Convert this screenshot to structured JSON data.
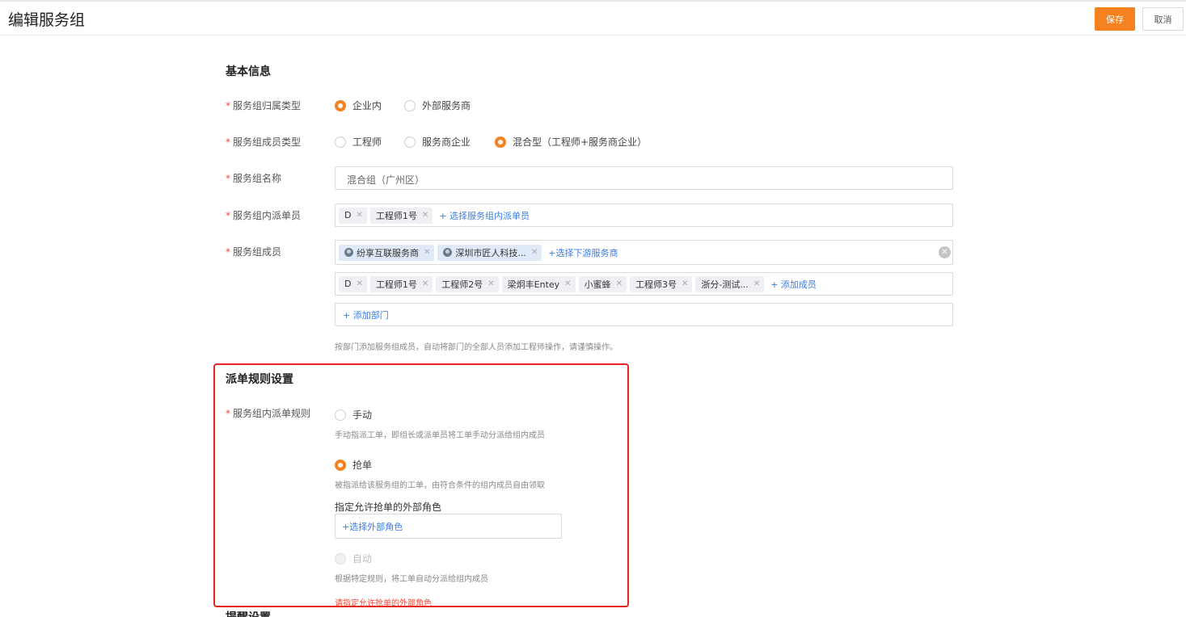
{
  "header": {
    "title": "编辑服务组",
    "save_label": "保存",
    "cancel_label": "取消"
  },
  "basic_info": {
    "section_title": "基本信息",
    "ownership_type": {
      "label": "服务组归属类型",
      "options": [
        "企业内",
        "外部服务商"
      ],
      "selected": "企业内"
    },
    "member_type": {
      "label": "服务组成员类型",
      "options": [
        "工程师",
        "服务商企业",
        "混合型（工程师+服务商企业）"
      ],
      "selected": "混合型（工程师+服务商企业）"
    },
    "group_name": {
      "label": "服务组名称",
      "value": "混合组（广州区）"
    },
    "dispatchers": {
      "label": "服务组内派单员",
      "tags": [
        "D",
        "工程师1号"
      ],
      "add_link": "+ 选择服务组内派单员"
    },
    "members": {
      "label": "服务组成员",
      "provider_tags": [
        "纷享互联服务商",
        "深圳市匠人科技..."
      ],
      "provider_add_link": "+选择下游服务商",
      "member_tags": [
        "D",
        "工程师1号",
        "工程师2号",
        "梁炯丰Entey",
        "小蜜蜂",
        "工程师3号",
        "浙分-测试..."
      ],
      "member_add_link": "+ 添加成员",
      "department_add_link": "+ 添加部门",
      "hint": "按部门添加服务组成员，自动将部门的全部人员添加工程师操作，请谨慎操作。"
    }
  },
  "dispatch_rules": {
    "section_title": "派单规则设置",
    "label": "服务组内派单规则",
    "options": [
      {
        "label": "手动",
        "desc": "手动指派工单，即组长或派单员将工单手动分派给组内成员",
        "state": "off"
      },
      {
        "label": "抢单",
        "desc": "被指派给该服务组的工单，由符合条件的组内成员自由领取",
        "state": "on"
      },
      {
        "label": "自动",
        "desc": "根据特定规则，将工单自动分派给组内成员",
        "state": "disabled"
      }
    ],
    "role_title": "指定允许抢单的外部角色",
    "role_add_link": "+选择外部角色",
    "error": "请指定允许抢单的外部角色"
  },
  "reminder": {
    "section_title": "提醒设置"
  },
  "colors": {
    "accent": "#f5811f",
    "link": "#3d7de0",
    "error": "#f04a3c",
    "highlight_box": "#e8231f"
  }
}
